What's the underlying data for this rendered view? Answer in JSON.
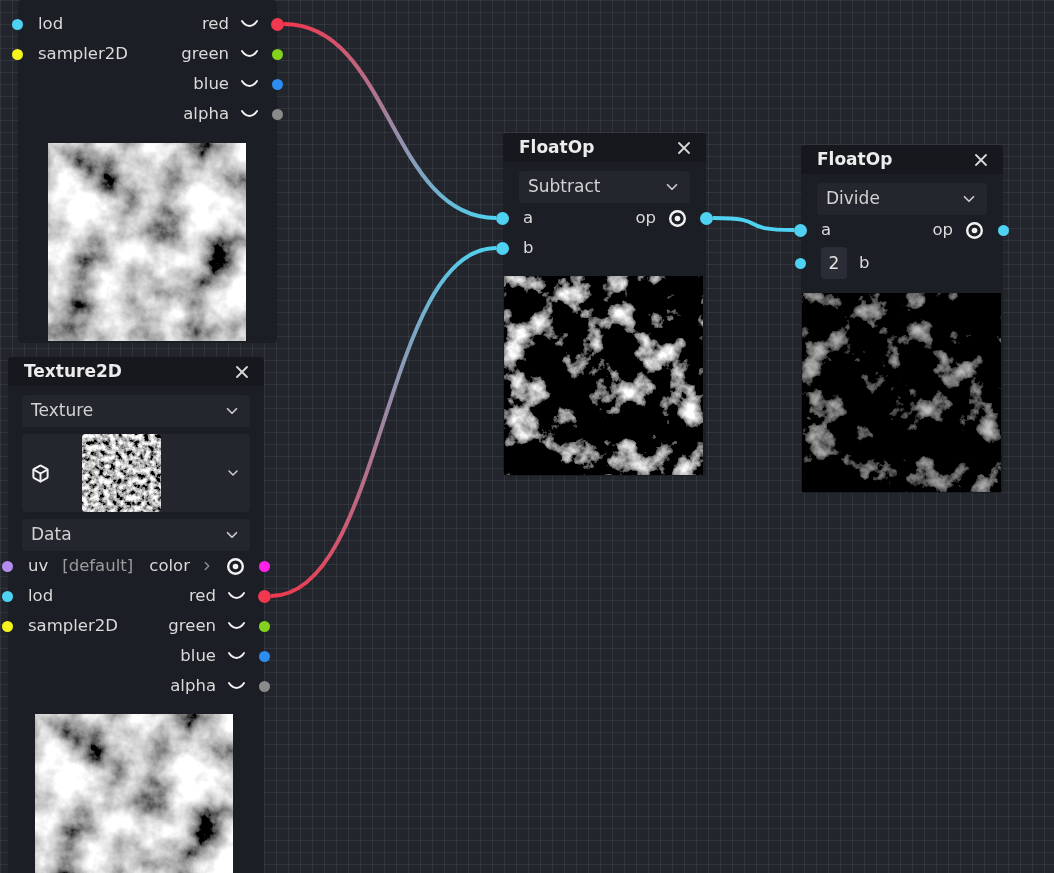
{
  "nodes": [
    {
      "rows": [
        {
          "input": {
            "label": "lod",
            "color": "#4fd2f2",
            "connected": false
          },
          "output": {
            "label": "red",
            "color": "#f0384e",
            "kind": "curve",
            "connected": true
          }
        },
        {
          "input": {
            "label": "sampler2D",
            "color": "#f5f51e",
            "connected": false
          },
          "output": {
            "label": "green",
            "color": "#84d21e",
            "kind": "curve",
            "connected": false
          }
        },
        {
          "output": {
            "label": "blue",
            "color": "#2d8cf0",
            "kind": "curve",
            "connected": false
          }
        },
        {
          "output": {
            "label": "alpha",
            "color": "#8a8a8a",
            "kind": "curve",
            "connected": false
          }
        }
      ],
      "preview": {
        "kind": "bright"
      }
    },
    {
      "title": "Texture2D",
      "fields": [
        {
          "kind": "select",
          "value": "Texture"
        },
        {
          "kind": "texture_picker"
        },
        {
          "kind": "select",
          "value": "Data"
        }
      ],
      "rows": [
        {
          "input": {
            "label": "uv",
            "hint": "[default]",
            "color": "#b48cf0",
            "connected": false
          },
          "output": {
            "label": "color",
            "color": "#ff22e6",
            "kind": "eye",
            "expandable": true,
            "connected": false
          }
        },
        {
          "input": {
            "label": "lod",
            "color": "#4fd2f2",
            "connected": false
          },
          "output": {
            "label": "red",
            "color": "#f0384e",
            "kind": "curve",
            "connected": true
          }
        },
        {
          "input": {
            "label": "sampler2D",
            "color": "#f5f51e",
            "connected": false
          },
          "output": {
            "label": "green",
            "color": "#84d21e",
            "kind": "curve",
            "connected": false
          }
        },
        {
          "output": {
            "label": "blue",
            "color": "#2d8cf0",
            "kind": "curve",
            "connected": false
          }
        },
        {
          "output": {
            "label": "alpha",
            "color": "#8a8a8a",
            "kind": "curve",
            "connected": false
          }
        }
      ],
      "preview": {
        "kind": "bright"
      }
    },
    {
      "title": "FloatOp",
      "fields": [
        {
          "kind": "select",
          "value": "Subtract"
        }
      ],
      "rows": [
        {
          "input": {
            "label": "a",
            "color": "#4fd2f2",
            "connected": true
          },
          "output": {
            "label": "op",
            "color": "#4fd2f2",
            "kind": "eye",
            "connected": true
          }
        },
        {
          "input": {
            "label": "b",
            "color": "#4fd2f2",
            "connected": true
          }
        }
      ],
      "preview": {
        "kind": "sparse"
      }
    },
    {
      "title": "FloatOp",
      "fields": [
        {
          "kind": "select",
          "value": "Divide"
        }
      ],
      "rows": [
        {
          "input": {
            "label": "a",
            "color": "#4fd2f2",
            "connected": true
          },
          "output": {
            "label": "op",
            "color": "#4fd2f2",
            "kind": "eye",
            "connected": false
          }
        },
        {
          "input": {
            "label": "b",
            "value": "2",
            "color": "#4fd2f2",
            "connected": false
          }
        }
      ],
      "preview": {
        "kind": "faint"
      }
    }
  ]
}
